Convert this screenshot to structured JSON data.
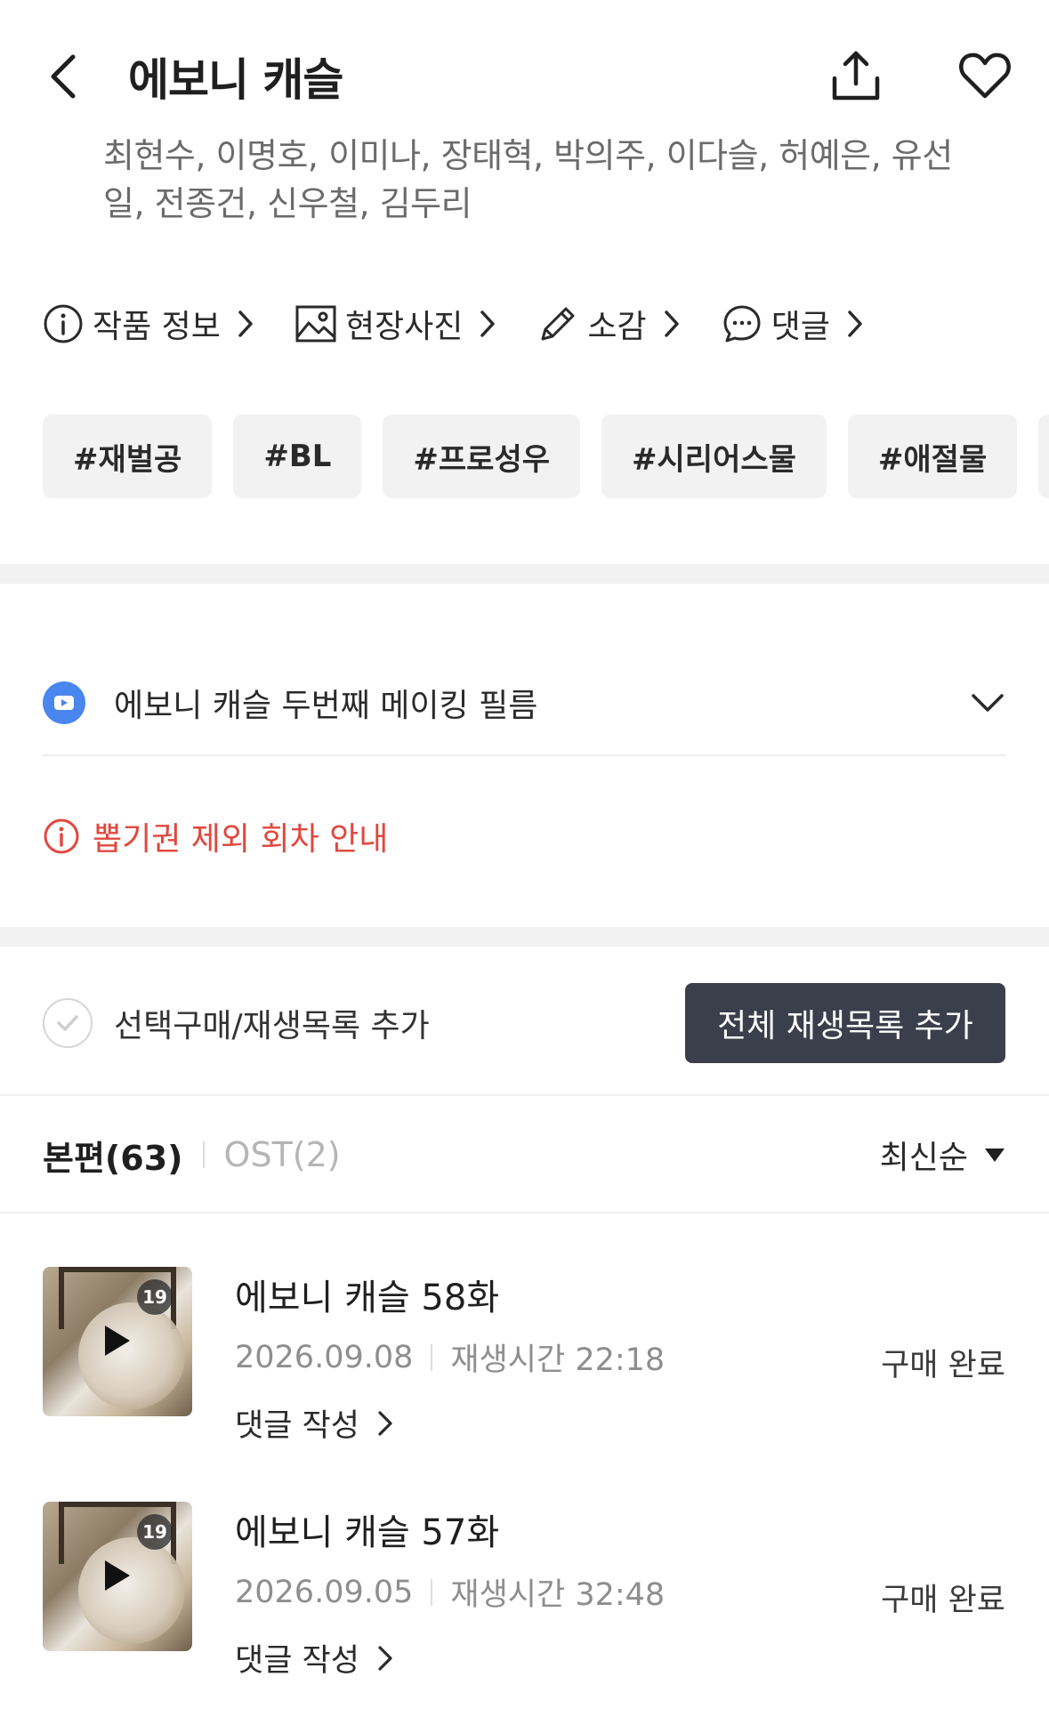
{
  "header": {
    "title": "에보니 캐슬",
    "cast": "최현수, 이명호, 이미나, 장태혁, 박의주, 이다슬, 허예은, 유선일, 전종건, 신우철, 김두리"
  },
  "links": [
    {
      "label": "작품 정보",
      "icon": "info-icon"
    },
    {
      "label": "현장사진",
      "icon": "image-icon"
    },
    {
      "label": "소감",
      "icon": "pencil-icon"
    },
    {
      "label": "댓글",
      "icon": "chat-icon"
    }
  ],
  "tags": [
    "#재벌공",
    "#BL",
    "#프로성우",
    "#시리어스물",
    "#애절물"
  ],
  "making": {
    "label": "에보니 캐슬 두번째 메이킹 필름"
  },
  "notice": {
    "label": "뽑기권 제외 회차 안내"
  },
  "select": {
    "label": "선택구매/재생목록 추가",
    "all_button": "전체 재생목록 추가"
  },
  "tabs": {
    "main": "본편(63)",
    "ost": "OST(2)",
    "sort": "최신순"
  },
  "episodes": [
    {
      "title": "에보니 캐슬 58화",
      "date": "2026.09.08",
      "duration": "재생시간 22:18",
      "comment": "댓글 작성",
      "status": "구매 완료",
      "age": "19"
    },
    {
      "title": "에보니 캐슬 57화",
      "date": "2026.09.05",
      "duration": "재생시간 32:48",
      "comment": "댓글 작성",
      "status": "구매 완료",
      "age": "19"
    }
  ],
  "colors": {
    "accent_blue": "#4a86f0",
    "notice_red": "#e0483f",
    "button_dark": "#3b3f4c"
  }
}
